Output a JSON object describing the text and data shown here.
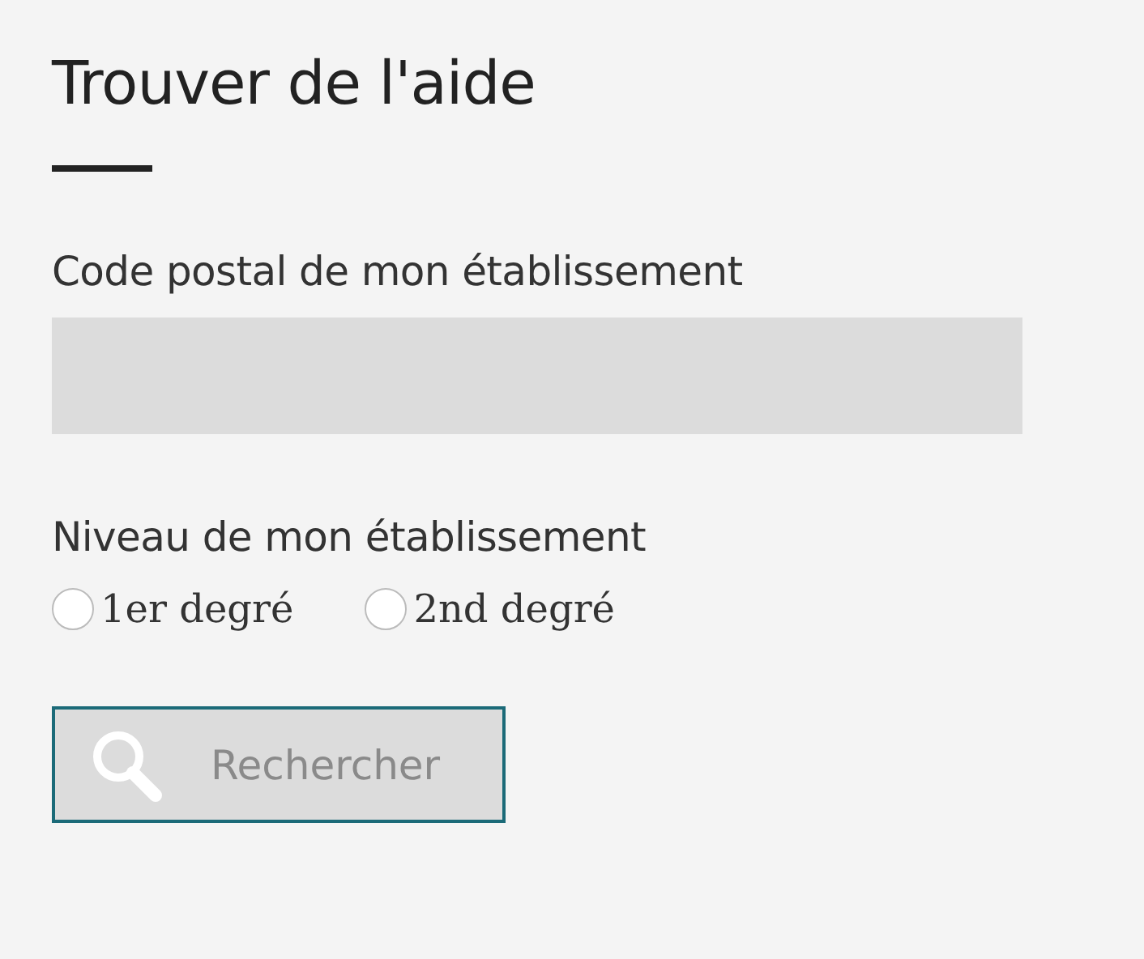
{
  "title": "Trouver de l'aide",
  "postal_field": {
    "label": "Code postal de mon établissement"
  },
  "level_group": {
    "label": "Niveau de mon établissement",
    "options": [
      {
        "label": "1er degré",
        "selected": false
      },
      {
        "label": "2nd degré",
        "selected": false
      }
    ]
  },
  "search_button": {
    "label": "Rechercher"
  }
}
